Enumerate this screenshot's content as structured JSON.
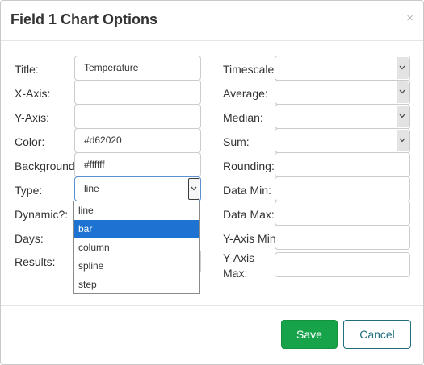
{
  "dialog": {
    "title": "Field 1 Chart Options",
    "close_glyph": "×"
  },
  "left_form": {
    "title_label": "Title:",
    "title_value": "Temperature",
    "xaxis_label": "X-Axis:",
    "xaxis_value": "",
    "yaxis_label": "Y-Axis:",
    "yaxis_value": "",
    "color_label": "Color:",
    "color_value": "#d62020",
    "background_label": "Background:",
    "background_value": "#ffffff",
    "type_label": "Type:",
    "type_value": "line",
    "dynamic_label": "Dynamic?:",
    "days_label": "Days:",
    "results_label": "Results:"
  },
  "type_dropdown": {
    "options": [
      "line",
      "bar",
      "column",
      "spline",
      "step"
    ],
    "highlighted": "bar"
  },
  "right_form": {
    "timescale_label": "Timescale:",
    "timescale_value": "",
    "average_label": "Average:",
    "average_value": "",
    "median_label": "Median:",
    "median_value": "",
    "sum_label": "Sum:",
    "sum_value": "",
    "rounding_label": "Rounding:",
    "rounding_value": "",
    "datamin_label": "Data Min:",
    "datamin_value": "",
    "datamax_label": "Data Max:",
    "datamax_value": "",
    "yaxismin_label": "Y-Axis Min:",
    "yaxismin_value": "",
    "yaxismax_label_line1": "Y-Axis",
    "yaxismax_label_line2": "Max:",
    "yaxismax_value": ""
  },
  "footer": {
    "save_label": "Save",
    "cancel_label": "Cancel"
  },
  "colors": {
    "save": "#16a34a",
    "cancel": "#1f6f7e",
    "highlight": "#1e73d2"
  },
  "icons": {
    "select_arrow": "chevron-down-icon",
    "close": "close-icon"
  }
}
